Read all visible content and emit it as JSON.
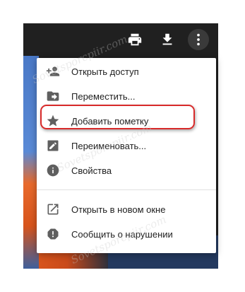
{
  "toolbar": {
    "icons": [
      "print-icon",
      "download-icon",
      "more-vertical-icon"
    ]
  },
  "menu": {
    "items": [
      {
        "label": "Открыть доступ",
        "icon": "person-add-icon"
      },
      {
        "label": "Переместить...",
        "icon": "folder-move-icon"
      },
      {
        "label": "Добавить пометку",
        "icon": "star-icon"
      },
      {
        "label": "Переименовать...",
        "icon": "rename-icon"
      },
      {
        "label": "Свойства",
        "icon": "info-icon"
      },
      {
        "label": "Открыть в новом окне",
        "icon": "open-new-window-icon"
      },
      {
        "label": "Сообщить о нарушении",
        "icon": "report-icon"
      }
    ],
    "highlighted_item": "Добавить пометку"
  },
  "watermark": {
    "text": "Sovetsporcpiir.com"
  },
  "colors": {
    "highlight_border": "#d82a2a",
    "icon": "#5f5f5f",
    "topbar": "#202020"
  }
}
